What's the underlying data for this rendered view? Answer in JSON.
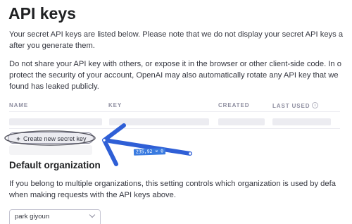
{
  "page": {
    "title": "API keys",
    "intro_lines": [
      "Your secret API keys are listed below. Please note that we do not display your secret API keys a",
      "after you generate them."
    ],
    "warning_lines": [
      "Do not share your API key with others, or expose it in the browser or other client-side code. In o",
      "protect the security of your account, OpenAI may also automatically rotate any API key that we",
      "found has leaked publicly."
    ]
  },
  "table": {
    "columns": {
      "name": "NAME",
      "key": "KEY",
      "created": "CREATED",
      "last_used": "LAST USED"
    },
    "icons": {
      "last_used_info": "info-icon"
    }
  },
  "actions": {
    "create_label": "Create new secret key",
    "create_icon": "+"
  },
  "organization": {
    "title": "Default organization",
    "description_lines": [
      "If you belong to multiple organizations, this setting controls which organization is used by defa",
      "when making requests with the API keys above."
    ],
    "selected": "park giyoun",
    "select_icon": "chevron-down-icon"
  },
  "annotation": {
    "dimension_label": "235,92 × 0",
    "color": "#2f5fd6",
    "badge_color": "#3a7be0"
  }
}
